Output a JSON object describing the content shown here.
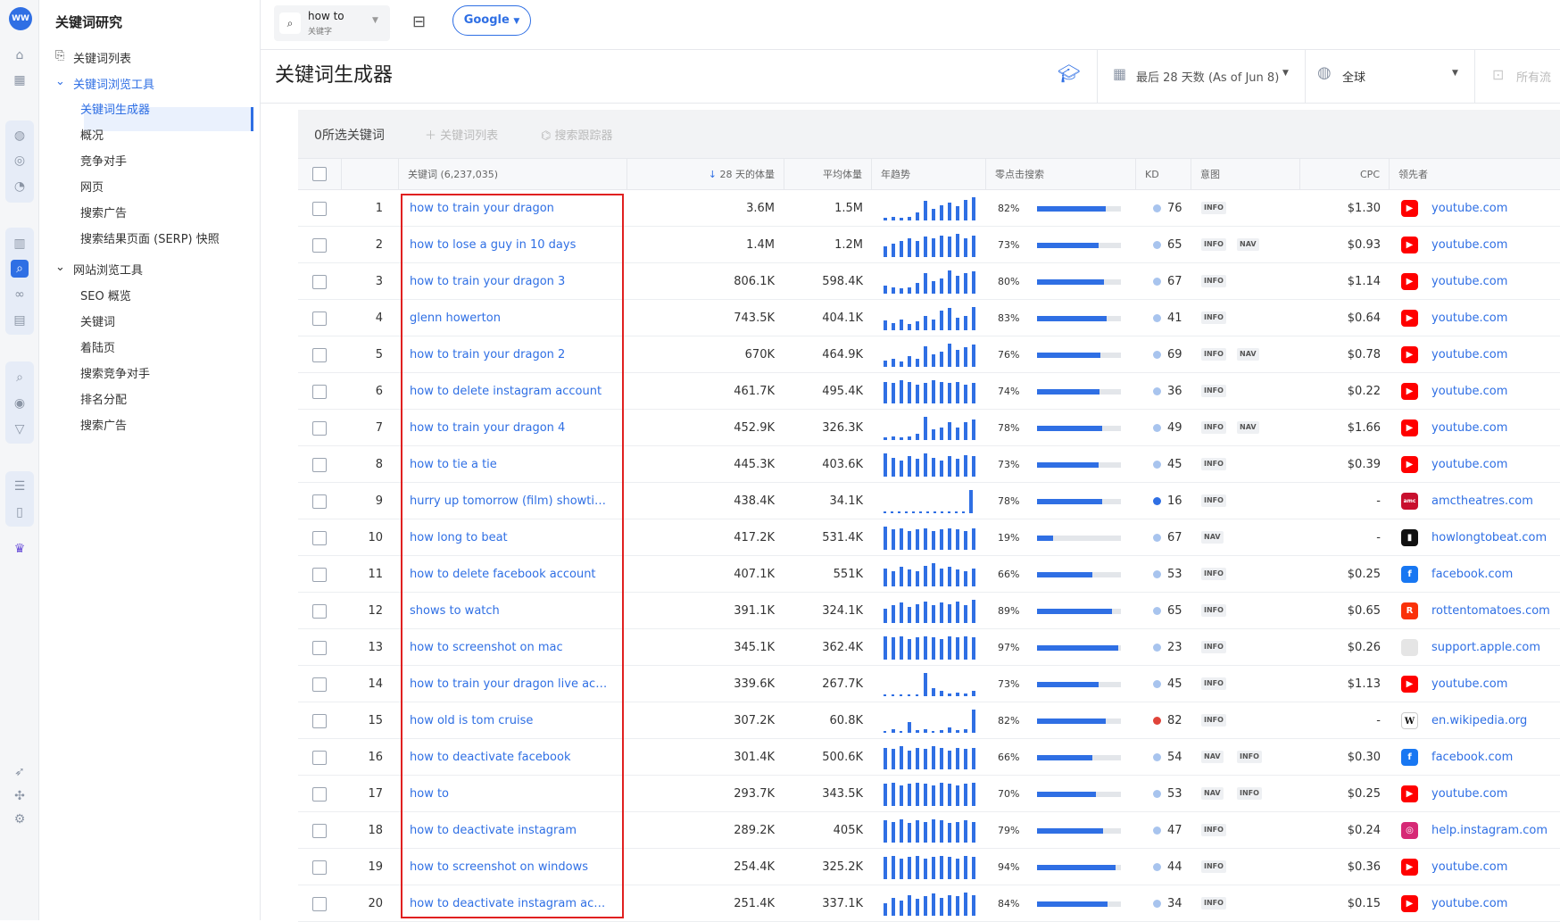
{
  "app": {
    "logo": "WW",
    "title": "关键词研究"
  },
  "sidebar": {
    "keyword_list": "关键词列表",
    "group1": "关键词浏览工具",
    "group1_items": [
      "关键词生成器",
      "概况",
      "竞争对手",
      "网页",
      "搜索广告",
      "搜索结果页面 (SERP) 快照"
    ],
    "group2": "网站浏览工具",
    "group2_items": [
      "SEO 概览",
      "关键词",
      "着陆页",
      "搜索竞争对手",
      "排名分配",
      "搜索广告"
    ]
  },
  "topbar": {
    "search_value": "how to",
    "search_type": "关键字",
    "engine": "Google"
  },
  "page": {
    "title": "关键词生成器",
    "date_range": "最后 28 天数 (As of Jun 8)",
    "region": "全球",
    "traffic": "所有流"
  },
  "table": {
    "selected": "0所选关键词",
    "add_to_list": "关键词列表",
    "tracker": "搜索跟踪器",
    "headers": {
      "keyword": "关键词 (6,237,035)",
      "volume28": "28 天的体量",
      "avg_volume": "平均体量",
      "trend": "年趋势",
      "zero_click": "零点击搜索",
      "kd": "KD",
      "intent": "意图",
      "cpc": "CPC",
      "leader": "领先者"
    },
    "rows": [
      {
        "n": "1",
        "kw": "how to train your dragon",
        "v28": "3.6M",
        "avg": "1.5M",
        "zc": "82%",
        "zcv": 82,
        "kd": "76",
        "kdc": "#a8c4ee",
        "intent": [
          "INFO"
        ],
        "cpc": "$1.30",
        "dom": "youtube.com",
        "fav": "yt",
        "trend": [
          2,
          3,
          2,
          3,
          6,
          15,
          9,
          12,
          14,
          11,
          16,
          18
        ]
      },
      {
        "n": "2",
        "kw": "how to lose a guy in 10 days",
        "v28": "1.4M",
        "avg": "1.2M",
        "zc": "73%",
        "zcv": 73,
        "kd": "65",
        "kdc": "#a8c4ee",
        "intent": [
          "INFO",
          "NAV"
        ],
        "cpc": "$0.93",
        "dom": "youtube.com",
        "fav": "yt",
        "trend": [
          8,
          10,
          12,
          14,
          12,
          15,
          14,
          16,
          15,
          17,
          14,
          16
        ]
      },
      {
        "n": "3",
        "kw": "how to train your dragon 3",
        "v28": "806.1K",
        "avg": "598.4K",
        "zc": "80%",
        "zcv": 80,
        "kd": "67",
        "kdc": "#a8c4ee",
        "intent": [
          "INFO"
        ],
        "cpc": "$1.14",
        "dom": "youtube.com",
        "fav": "yt",
        "trend": [
          6,
          5,
          4,
          5,
          8,
          16,
          10,
          12,
          18,
          14,
          16,
          17
        ]
      },
      {
        "n": "4",
        "kw": "glenn howerton",
        "v28": "743.5K",
        "avg": "404.1K",
        "zc": "83%",
        "zcv": 83,
        "kd": "41",
        "kdc": "#a8c4ee",
        "intent": [
          "INFO"
        ],
        "cpc": "$0.64",
        "dom": "youtube.com",
        "fav": "yt",
        "trend": [
          8,
          6,
          9,
          5,
          7,
          12,
          9,
          16,
          18,
          10,
          12,
          19
        ]
      },
      {
        "n": "5",
        "kw": "how to train your dragon 2",
        "v28": "670K",
        "avg": "464.9K",
        "zc": "76%",
        "zcv": 76,
        "kd": "69",
        "kdc": "#a8c4ee",
        "intent": [
          "INFO",
          "NAV"
        ],
        "cpc": "$0.78",
        "dom": "youtube.com",
        "fav": "yt",
        "trend": [
          5,
          6,
          4,
          8,
          6,
          16,
          10,
          12,
          18,
          13,
          15,
          17
        ]
      },
      {
        "n": "6",
        "kw": "how to delete instagram account",
        "v28": "461.7K",
        "avg": "495.4K",
        "zc": "74%",
        "zcv": 74,
        "kd": "36",
        "kdc": "#a8c4ee",
        "intent": [
          "INFO"
        ],
        "cpc": "$0.22",
        "dom": "youtube.com",
        "fav": "yt",
        "trend": [
          16,
          15,
          17,
          16,
          14,
          15,
          17,
          16,
          15,
          16,
          14,
          15
        ]
      },
      {
        "n": "7",
        "kw": "how to train your dragon 4",
        "v28": "452.9K",
        "avg": "326.3K",
        "zc": "78%",
        "zcv": 78,
        "kd": "49",
        "kdc": "#a8c4ee",
        "intent": [
          "INFO",
          "NAV"
        ],
        "cpc": "$1.66",
        "dom": "youtube.com",
        "fav": "yt",
        "trend": [
          2,
          3,
          2,
          3,
          5,
          18,
          8,
          10,
          14,
          10,
          14,
          16
        ]
      },
      {
        "n": "8",
        "kw": "how to tie a tie",
        "v28": "445.3K",
        "avg": "403.6K",
        "zc": "73%",
        "zcv": 73,
        "kd": "45",
        "kdc": "#a8c4ee",
        "intent": [
          "INFO"
        ],
        "cpc": "$0.39",
        "dom": "youtube.com",
        "fav": "yt",
        "trend": [
          17,
          14,
          12,
          15,
          13,
          17,
          14,
          12,
          15,
          13,
          16,
          15
        ]
      },
      {
        "n": "9",
        "kw": "hurry up tomorrow (film) showtimes",
        "v28": "438.4K",
        "avg": "34.1K",
        "zc": "78%",
        "zcv": 78,
        "kd": "16",
        "kdc": "#2f6fe4",
        "intent": [
          "INFO"
        ],
        "cpc": "-",
        "dom": "amctheatres.com",
        "fav": "amc",
        "trend": [
          1,
          1,
          1,
          1,
          1,
          1,
          1,
          1,
          1,
          1,
          1,
          1,
          20
        ]
      },
      {
        "n": "10",
        "kw": "how long to beat",
        "v28": "417.2K",
        "avg": "531.4K",
        "zc": "19%",
        "zcv": 19,
        "kd": "67",
        "kdc": "#a8c4ee",
        "intent": [
          "NAV"
        ],
        "cpc": "-",
        "dom": "howlongtobeat.com",
        "fav": "hl",
        "trend": [
          17,
          15,
          16,
          14,
          15,
          16,
          14,
          15,
          16,
          15,
          14,
          16
        ]
      },
      {
        "n": "11",
        "kw": "how to delete facebook account",
        "v28": "407.1K",
        "avg": "551K",
        "zc": "66%",
        "zcv": 66,
        "kd": "53",
        "kdc": "#a8c4ee",
        "intent": [
          "INFO"
        ],
        "cpc": "$0.25",
        "dom": "facebook.com",
        "fav": "fb",
        "trend": [
          14,
          12,
          15,
          13,
          12,
          16,
          18,
          14,
          15,
          13,
          12,
          14
        ]
      },
      {
        "n": "12",
        "kw": "shows to watch",
        "v28": "391.1K",
        "avg": "324.1K",
        "zc": "89%",
        "zcv": 89,
        "kd": "65",
        "kdc": "#a8c4ee",
        "intent": [
          "INFO"
        ],
        "cpc": "$0.65",
        "dom": "rottentomatoes.com",
        "fav": "rt",
        "trend": [
          10,
          12,
          14,
          11,
          13,
          15,
          12,
          14,
          13,
          15,
          12,
          16
        ]
      },
      {
        "n": "13",
        "kw": "how to screenshot on mac",
        "v28": "345.1K",
        "avg": "362.4K",
        "zc": "97%",
        "zcv": 97,
        "kd": "23",
        "kdc": "#a8c4ee",
        "intent": [
          "INFO"
        ],
        "cpc": "$0.26",
        "dom": "support.apple.com",
        "fav": "ap",
        "trend": [
          18,
          17,
          18,
          16,
          17,
          18,
          17,
          16,
          18,
          17,
          18,
          17
        ]
      },
      {
        "n": "14",
        "kw": "how to train your dragon live action",
        "v28": "339.6K",
        "avg": "267.7K",
        "zc": "73%",
        "zcv": 73,
        "kd": "45",
        "kdc": "#a8c4ee",
        "intent": [
          "INFO"
        ],
        "cpc": "$1.13",
        "dom": "youtube.com",
        "fav": "yt",
        "trend": [
          1,
          1,
          1,
          1,
          1,
          18,
          6,
          4,
          2,
          3,
          2,
          4
        ]
      },
      {
        "n": "15",
        "kw": "how old is tom cruise",
        "v28": "307.2K",
        "avg": "60.8K",
        "zc": "82%",
        "zcv": 82,
        "kd": "82",
        "kdc": "#e0443a",
        "intent": [
          "INFO"
        ],
        "cpc": "-",
        "dom": "en.wikipedia.org",
        "fav": "wk",
        "trend": [
          1,
          3,
          1,
          8,
          2,
          3,
          1,
          2,
          4,
          2,
          3,
          18
        ]
      },
      {
        "n": "16",
        "kw": "how to deactivate facebook",
        "v28": "301.4K",
        "avg": "500.6K",
        "zc": "66%",
        "zcv": 66,
        "kd": "54",
        "kdc": "#a8c4ee",
        "intent": [
          "NAV",
          "INFO"
        ],
        "cpc": "$0.30",
        "dom": "facebook.com",
        "fav": "fb",
        "trend": [
          16,
          15,
          17,
          14,
          16,
          15,
          17,
          16,
          14,
          16,
          15,
          16
        ]
      },
      {
        "n": "17",
        "kw": "how to",
        "v28": "293.7K",
        "avg": "343.5K",
        "zc": "70%",
        "zcv": 70,
        "kd": "53",
        "kdc": "#a8c4ee",
        "intent": [
          "NAV",
          "INFO"
        ],
        "cpc": "$0.25",
        "dom": "youtube.com",
        "fav": "yt",
        "trend": [
          17,
          18,
          16,
          17,
          18,
          17,
          16,
          18,
          17,
          16,
          17,
          18
        ]
      },
      {
        "n": "18",
        "kw": "how to deactivate instagram",
        "v28": "289.2K",
        "avg": "405K",
        "zc": "79%",
        "zcv": 79,
        "kd": "47",
        "kdc": "#a8c4ee",
        "intent": [
          "INFO"
        ],
        "cpc": "$0.24",
        "dom": "help.instagram.com",
        "fav": "ig",
        "trend": [
          17,
          16,
          18,
          15,
          17,
          16,
          18,
          17,
          15,
          16,
          17,
          16
        ]
      },
      {
        "n": "19",
        "kw": "how to screenshot on windows",
        "v28": "254.4K",
        "avg": "325.2K",
        "zc": "94%",
        "zcv": 94,
        "kd": "44",
        "kdc": "#a8c4ee",
        "intent": [
          "INFO"
        ],
        "cpc": "$0.36",
        "dom": "youtube.com",
        "fav": "yt",
        "trend": [
          17,
          18,
          16,
          17,
          18,
          16,
          17,
          18,
          17,
          16,
          18,
          17
        ]
      },
      {
        "n": "20",
        "kw": "how to deactivate instagram account",
        "v28": "251.4K",
        "avg": "337.1K",
        "zc": "84%",
        "zcv": 84,
        "kd": "34",
        "kdc": "#a8c4ee",
        "intent": [
          "INFO"
        ],
        "cpc": "$0.15",
        "dom": "youtube.com",
        "fav": "yt",
        "trend": [
          10,
          14,
          12,
          16,
          13,
          15,
          17,
          14,
          16,
          15,
          18,
          16
        ]
      }
    ]
  },
  "colors": {
    "accent": "#2f6fe4",
    "highlight_border": "#e02020"
  }
}
